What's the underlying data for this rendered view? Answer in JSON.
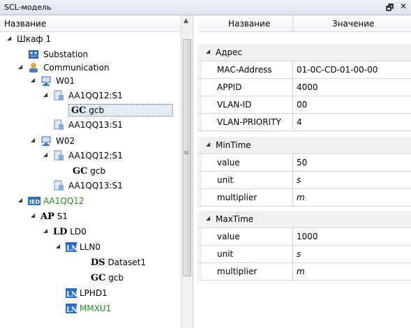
{
  "window": {
    "title": "SCL-модель",
    "float_glyph": "↔",
    "close_glyph": "×"
  },
  "tree": {
    "header": "Название",
    "nodes": [
      {
        "label": "Шкаф 1",
        "expander": "◢",
        "icon": "none",
        "color": "#000000"
      },
      {
        "label": "Substation",
        "icon": "substation-icon"
      },
      {
        "label": "Communication",
        "expander": "◢",
        "icon": "communication-icon"
      },
      {
        "label": "W01",
        "expander": "◢",
        "icon": "subnetwork-icon"
      },
      {
        "label": "AA1QQ12:S1",
        "expander": "◢",
        "icon": "access-point-icon"
      },
      {
        "label": "gcb",
        "prefix": "GC",
        "selected": true
      },
      {
        "label": "AA1QQ13:S1",
        "icon": "access-point-icon"
      },
      {
        "label": "W02",
        "expander": "◢",
        "icon": "subnetwork-icon"
      },
      {
        "label": "AA1QQ12:S1",
        "expander": "◢",
        "icon": "access-point-icon"
      },
      {
        "label": "gcb",
        "prefix": "GC"
      },
      {
        "label": "AA1QQ13:S1",
        "icon": "access-point-icon"
      },
      {
        "label": "AA1QQ12",
        "expander": "◢",
        "icon": "ied-icon",
        "color": "#2a8a2a"
      },
      {
        "label": "S1",
        "prefix": "AP",
        "expander": "◢"
      },
      {
        "label": "LD0",
        "prefix": "LD",
        "expander": "◢"
      },
      {
        "label": "LLN0",
        "expander": "◢",
        "icon": "ln-icon"
      },
      {
        "label": "Dataset1",
        "prefix": "DS"
      },
      {
        "label": "gcb",
        "prefix": "GC"
      },
      {
        "label": "LPHD1",
        "icon": "ln-icon"
      },
      {
        "label": "MMXU1",
        "icon": "ln-icon",
        "color": "#2a8a2a"
      }
    ]
  },
  "props": {
    "col_name": "Название",
    "col_value": "Значение",
    "groups": [
      {
        "name": "Адрес",
        "rows": [
          {
            "key": "MAC-Address",
            "value": "01-0C-CD-01-00-00"
          },
          {
            "key": "APPID",
            "value": "4000"
          },
          {
            "key": "VLAN-ID",
            "value": "00"
          },
          {
            "key": "VLAN-PRIORITY",
            "value": "4"
          }
        ]
      },
      {
        "name": "MinTime",
        "rows": [
          {
            "key": "value",
            "value": "50"
          },
          {
            "key": "unit",
            "value": "s"
          },
          {
            "key": "multiplier",
            "value": "m"
          }
        ]
      },
      {
        "name": "MaxTime",
        "rows": [
          {
            "key": "value",
            "value": "1000"
          },
          {
            "key": "unit",
            "value": "s"
          },
          {
            "key": "multiplier",
            "value": "m"
          }
        ]
      }
    ]
  },
  "colors": {
    "tree_header_bg": "#f1f3f7",
    "category_bg": "#f0f0f0",
    "grid_line": "#cfd6df",
    "green_text": "#2a8a2a",
    "selection_bg": "#e3ecf8"
  }
}
